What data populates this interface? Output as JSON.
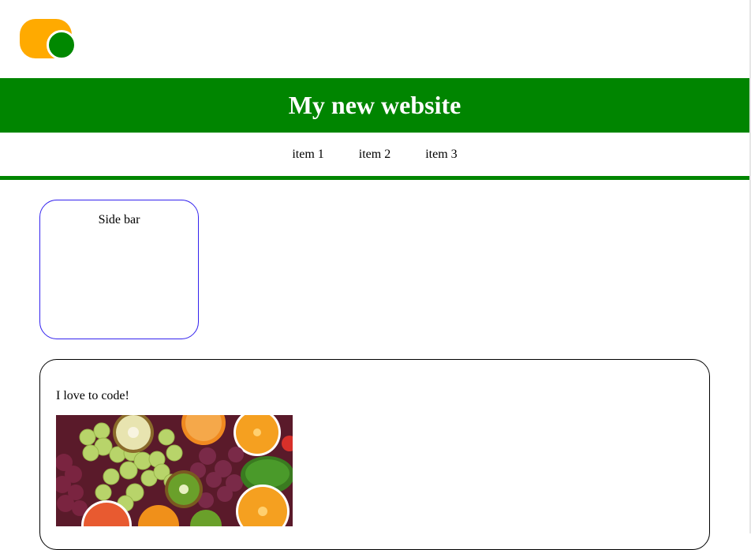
{
  "header": {
    "title": "My new website"
  },
  "nav": {
    "items": [
      "item 1",
      "item 2",
      "item 3"
    ]
  },
  "sidebar": {
    "label": "Side bar"
  },
  "main": {
    "text": "I love to code!"
  },
  "colors": {
    "brand_green": "#008500",
    "logo_orange": "#ffaa00",
    "sidebar_border": "#3322ee"
  }
}
